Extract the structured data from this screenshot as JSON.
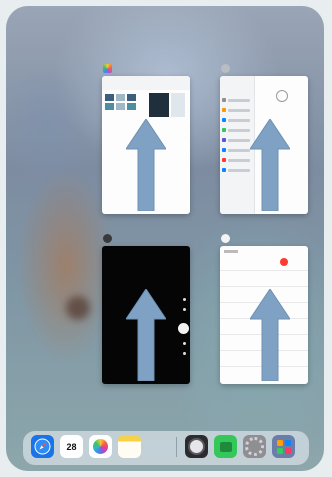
{
  "switcher": {
    "cards": [
      {
        "id": "c1",
        "app_title": "",
        "icon": "photos-app-icon",
        "has_arrow": true
      },
      {
        "id": "c2",
        "app_title": "",
        "icon": "settings-app-icon",
        "has_arrow": true
      },
      {
        "id": "c3",
        "app_title": "",
        "icon": "camera-app-icon",
        "has_arrow": true
      },
      {
        "id": "c4",
        "app_title": "",
        "icon": "calendar-app-icon",
        "has_arrow": true
      }
    ],
    "arrow_color": "#7fa2c4"
  },
  "dock": {
    "apps": [
      {
        "name": "safari",
        "label": ""
      },
      {
        "name": "calendar",
        "label": "28"
      },
      {
        "name": "photos",
        "label": ""
      },
      {
        "name": "notes",
        "label": ""
      },
      {
        "name": "camera",
        "label": ""
      },
      {
        "name": "app-store",
        "label": ""
      },
      {
        "name": "settings",
        "label": ""
      },
      {
        "name": "app-library",
        "label": ""
      }
    ]
  }
}
